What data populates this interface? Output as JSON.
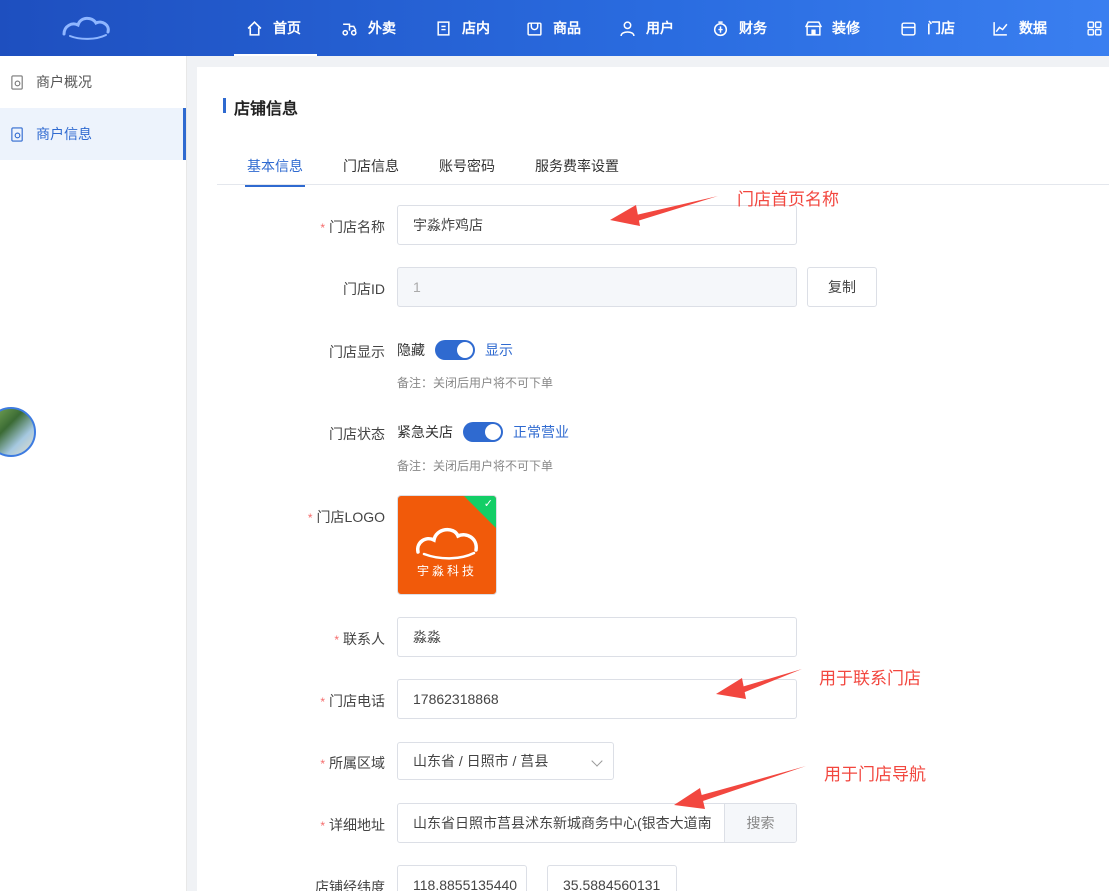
{
  "nav": {
    "items": [
      {
        "label": "首页",
        "icon": "home-icon"
      },
      {
        "label": "外卖",
        "icon": "delivery-icon"
      },
      {
        "label": "店内",
        "icon": "instore-icon"
      },
      {
        "label": "商品",
        "icon": "goods-icon"
      },
      {
        "label": "用户",
        "icon": "user-icon"
      },
      {
        "label": "财务",
        "icon": "finance-icon"
      },
      {
        "label": "装修",
        "icon": "decor-icon"
      },
      {
        "label": "门店",
        "icon": "store-icon"
      },
      {
        "label": "数据",
        "icon": "chart-icon"
      }
    ]
  },
  "sidebar": {
    "items": [
      {
        "label": "商户概况"
      },
      {
        "label": "商户信息"
      }
    ]
  },
  "page": {
    "title": "店铺信息",
    "tabs": [
      {
        "label": "基本信息"
      },
      {
        "label": "门店信息"
      },
      {
        "label": "账号密码"
      },
      {
        "label": "服务费率设置"
      }
    ]
  },
  "form": {
    "store_name": {
      "label": "门店名称",
      "value": "宇淼炸鸡店"
    },
    "store_id": {
      "label": "门店ID",
      "value": "1",
      "copy_label": "复制"
    },
    "store_display": {
      "label": "门店显示",
      "off": "隐藏",
      "on": "显示",
      "checked": true,
      "note": "备注：关闭后用户将不可下单"
    },
    "store_status": {
      "label": "门店状态",
      "off": "紧急关店",
      "on": "正常营业",
      "checked": true,
      "note": "备注：关闭后用户将不可下单"
    },
    "store_logo": {
      "label": "门店LOGO",
      "logo_text": "宇淼科技"
    },
    "contact": {
      "label": "联系人",
      "value": "淼淼"
    },
    "phone": {
      "label": "门店电话",
      "value": "17862318868"
    },
    "region": {
      "label": "所属区域",
      "value": "山东省 / 日照市 / 莒县"
    },
    "address": {
      "label": "详细地址",
      "value": "山东省日照市莒县沭东新城商务中心(银杏大道南",
      "search_label": "搜索"
    },
    "coords": {
      "label": "店铺经纬度",
      "lng": "118.8855135440",
      "lat": "35.5884560131"
    }
  },
  "annotations": {
    "name_hint": "门店首页名称",
    "contact_hint": "用于联系门店",
    "nav_hint": "用于门店导航"
  },
  "colors": {
    "primary": "#2f6ad0",
    "annotation": "#f2473f",
    "required": "#f56c6c",
    "logo_bg": "#f15a0a"
  }
}
